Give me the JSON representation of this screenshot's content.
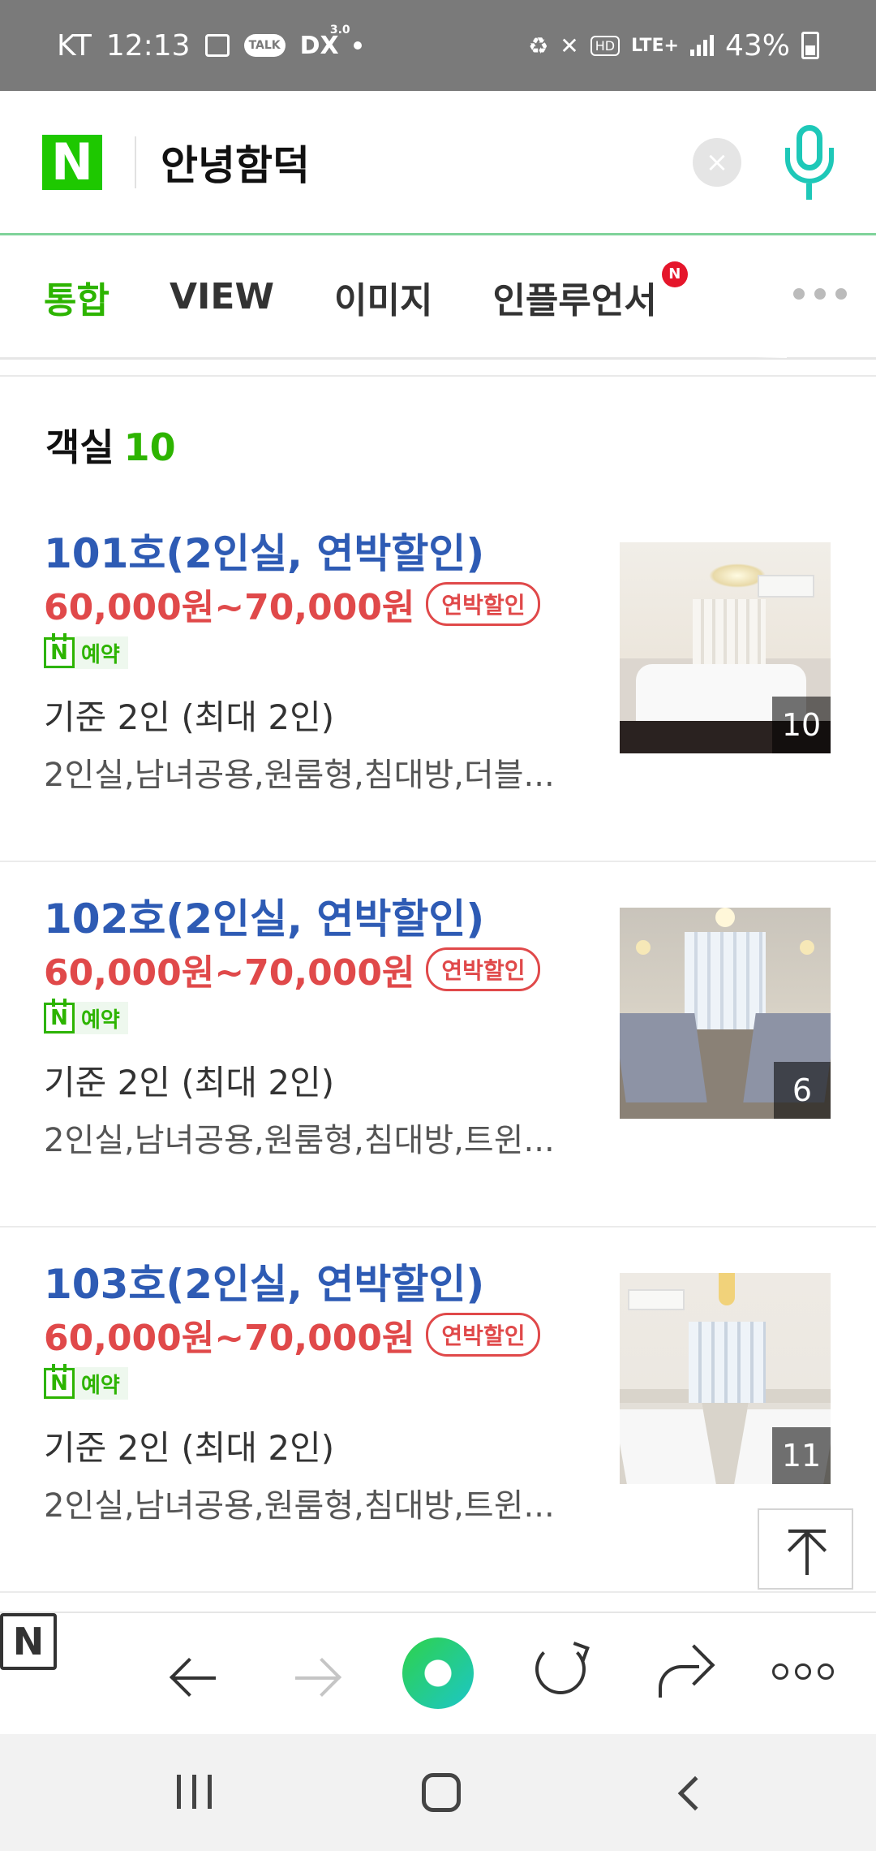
{
  "status_bar": {
    "carrier": "KT",
    "time": "12:13",
    "battery": "43%",
    "network": "LTE+",
    "icons": [
      "gallery-icon",
      "talk-icon",
      "dx-icon",
      "dot-icon",
      "battery-saver-icon",
      "mute-icon",
      "hd-icon",
      "lte-icon",
      "signal-icon",
      "battery-icon"
    ],
    "talk_label": "TALK",
    "dx_label": "DX",
    "dx_sup": "3.0",
    "hd_label": "HD"
  },
  "search": {
    "logo": "N",
    "query": "안녕함덕",
    "clear_icon": "×"
  },
  "tabs": {
    "items": [
      {
        "label": "통합",
        "active": true
      },
      {
        "label": "VIEW"
      },
      {
        "label": "이미지"
      },
      {
        "label": "인플루언서",
        "badge": "N"
      }
    ]
  },
  "section": {
    "title": "객실",
    "count": "10"
  },
  "rooms": [
    {
      "name": "101호(2인실, 연박할인)",
      "price": "60,000원~70,000원",
      "badge": "연박할인",
      "reserve_logo": "N",
      "reserve_label": "예약",
      "capacity": "기준 2인 (최대 2인)",
      "features": "2인실,남녀공용,원룸형,침대방,더블...",
      "photo_count": "10"
    },
    {
      "name": "102호(2인실, 연박할인)",
      "price": "60,000원~70,000원",
      "badge": "연박할인",
      "reserve_logo": "N",
      "reserve_label": "예약",
      "capacity": "기준 2인 (최대 2인)",
      "features": "2인실,남녀공용,원룸형,침대방,트윈...",
      "photo_count": "6"
    },
    {
      "name": "103호(2인실, 연박할인)",
      "price": "60,000원~70,000원",
      "badge": "연박할인",
      "reserve_logo": "N",
      "reserve_label": "예약",
      "capacity": "기준 2인 (최대 2인)",
      "features": "2인실,남녀공용,원룸형,침대방,트윈...",
      "photo_count": "11"
    }
  ],
  "toolbar": {
    "home_label": "N",
    "items": [
      "naver-home-icon",
      "back-arrow-icon",
      "forward-arrow-icon",
      "green-dot-icon",
      "reload-icon",
      "share-icon",
      "more-icon"
    ]
  },
  "colors": {
    "naver_green": "#1ec800",
    "active_tab": "#2db400",
    "room_name": "#2e5bb4",
    "price": "#e0494a",
    "mic": "#1ec8b8"
  }
}
